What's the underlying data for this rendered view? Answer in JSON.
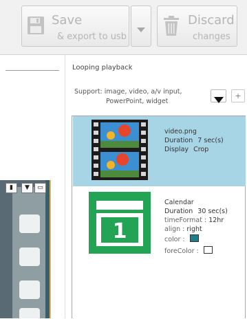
{
  "toolbar": {
    "save": {
      "label": "Save",
      "sublabel": "& export to usb"
    },
    "discard": {
      "label": "Discard",
      "sublabel": "changes"
    }
  },
  "panel": {
    "section_title": "Looping playback",
    "support_label": "Support:",
    "support_line1": "image, video, a/v input,",
    "support_line2": "PowerPoint, widget"
  },
  "playlist": {
    "items": [
      {
        "name": "video.png",
        "duration_label": "Duration",
        "duration_value": "7",
        "duration_unit": "sec(s)",
        "display_label": "Display",
        "display_value": "Crop",
        "selected": true
      },
      {
        "name": "Calendar",
        "duration_label": "Duration",
        "duration_value": "30",
        "duration_unit": "sec(s)",
        "params": [
          {
            "label": "timeFormat :",
            "value": "12hr"
          },
          {
            "label": "align :",
            "value": "right"
          },
          {
            "label": "color :",
            "swatch": "#1e7d8b"
          },
          {
            "label": "foreColor :",
            "swatch": "#ffffff"
          }
        ],
        "icon_number": "1"
      }
    ]
  },
  "colors": {
    "selected_bg": "#a8d5e6",
    "calendar_green": "#23a354",
    "color_swatch": "#1e7d8b",
    "forecolor_swatch": "#ffffff"
  }
}
